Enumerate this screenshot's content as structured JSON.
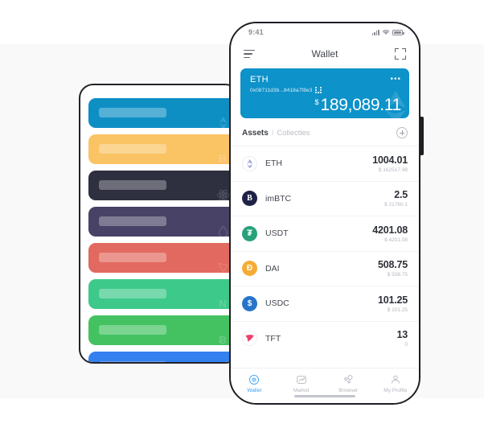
{
  "theme": {
    "accent": "#0d92c9",
    "tab_active": "#3a9ff5",
    "panel_border": "#1d1f24",
    "backdrop": "#f9f9fa"
  },
  "left_panel": {
    "name": "placeholder-card-stack",
    "cards": [
      {
        "color": "#0d8fc4",
        "icon": "ethereum-icon"
      },
      {
        "color": "#fac364",
        "icon": "bitcoin-icon"
      },
      {
        "color": "#2e3040",
        "icon": "cosmos-icon"
      },
      {
        "color": "#484266",
        "icon": "water-drop-icon"
      },
      {
        "color": "#e2695f",
        "icon": "tron-icon"
      },
      {
        "color": "#3dc98a",
        "icon": "nem-icon"
      },
      {
        "color": "#44c262",
        "icon": "bitcoin-cash-icon"
      },
      {
        "color": "#3580ef",
        "icon": "litecoin-icon"
      }
    ]
  },
  "phone": {
    "statusbar": {
      "time": "9:41",
      "signal_icon": "cellular-signal-icon",
      "wifi_icon": "wifi-icon",
      "battery_icon": "battery-icon"
    },
    "navbar": {
      "menu_icon": "hamburger-menu-icon",
      "title": "Wallet",
      "scan_icon": "scan-qr-icon"
    },
    "balance_card": {
      "symbol": "ETH",
      "address": "0x08711d3b...8418a7f8e3",
      "qr_icon": "qr-code-icon",
      "more_icon": "•••",
      "currency_symbol": "$",
      "amount": "189,089.11",
      "watermark_icon": "ethereum-icon"
    },
    "assets_header": {
      "tab_assets": "Assets",
      "separator": "/",
      "tab_collectibles": "Collectles",
      "add_icon": "plus-circle-icon"
    },
    "assets": [
      {
        "symbol": "ETH",
        "amount": "1004.01",
        "fiat": "$ 162517.48",
        "icon": "ethereum-icon",
        "icon_bg": "#ffffff",
        "icon_color": "#8a92d6"
      },
      {
        "symbol": "imBTC",
        "amount": "2.5",
        "fiat": "$ 21760.1",
        "icon": "imbtc-icon",
        "icon_bg": "#1e2246",
        "icon_color": "#ffffff"
      },
      {
        "symbol": "USDT",
        "amount": "4201.08",
        "fiat": "$ 4201.08",
        "icon": "tether-icon",
        "icon_bg": "#26a17b",
        "icon_color": "#ffffff"
      },
      {
        "symbol": "DAI",
        "amount": "508.75",
        "fiat": "$ 508.75",
        "icon": "dai-icon",
        "icon_bg": "#f5ac37",
        "icon_color": "#ffffff"
      },
      {
        "symbol": "USDC",
        "amount": "101.25",
        "fiat": "$ 101.25",
        "icon": "usdc-icon",
        "icon_bg": "#2775ca",
        "icon_color": "#ffffff"
      },
      {
        "symbol": "TFT",
        "amount": "13",
        "fiat": "0",
        "icon": "tft-icon",
        "icon_bg": "#ffffff",
        "icon_color": "#e8426a"
      }
    ],
    "tabbar": [
      {
        "label": "Wallet",
        "icon": "wallet-icon",
        "active": true
      },
      {
        "label": "Market",
        "icon": "market-chart-icon",
        "active": false
      },
      {
        "label": "Browser",
        "icon": "browser-nodes-icon",
        "active": false
      },
      {
        "label": "My Profile",
        "icon": "user-profile-icon",
        "active": false
      }
    ]
  }
}
